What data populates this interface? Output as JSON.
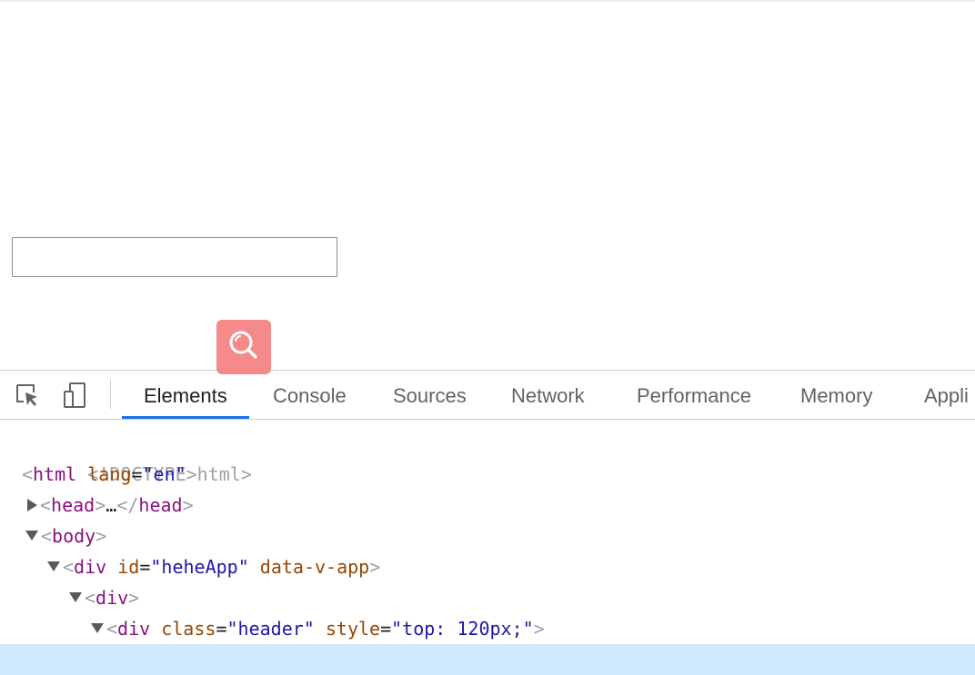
{
  "page": {
    "input_value": "",
    "input_placeholder": "",
    "search_button_icon": "search-icon",
    "search_button_color": "#f48a8a"
  },
  "devtools": {
    "toolbar_icons": [
      "inspect-element-icon",
      "device-toolbar-icon"
    ],
    "tabs": [
      {
        "label": "Elements",
        "active": true
      },
      {
        "label": "Console",
        "active": false
      },
      {
        "label": "Sources",
        "active": false
      },
      {
        "label": "Network",
        "active": false
      },
      {
        "label": "Performance",
        "active": false
      },
      {
        "label": "Memory",
        "active": false
      },
      {
        "label": "Appli",
        "active": false
      }
    ],
    "accent_color": "#1a73e8",
    "dom": {
      "doctype": "<!DOCTYPE html>",
      "html_tag": "html",
      "html_attr": "lang",
      "html_val": "\"en\"",
      "head_tag": "head",
      "head_ellipsis": "…",
      "body_tag": "body",
      "app_div_tag": "div",
      "app_id_attr": "id",
      "app_id_val": "\"heheApp\"",
      "app_data_attr": "data-v-app",
      "inner_div_tag": "div",
      "header_div_tag": "div",
      "header_class_attr": "class",
      "header_class_val": "\"header\"",
      "header_style_attr": "style",
      "header_style_val": "\"top: 120px;\""
    }
  }
}
